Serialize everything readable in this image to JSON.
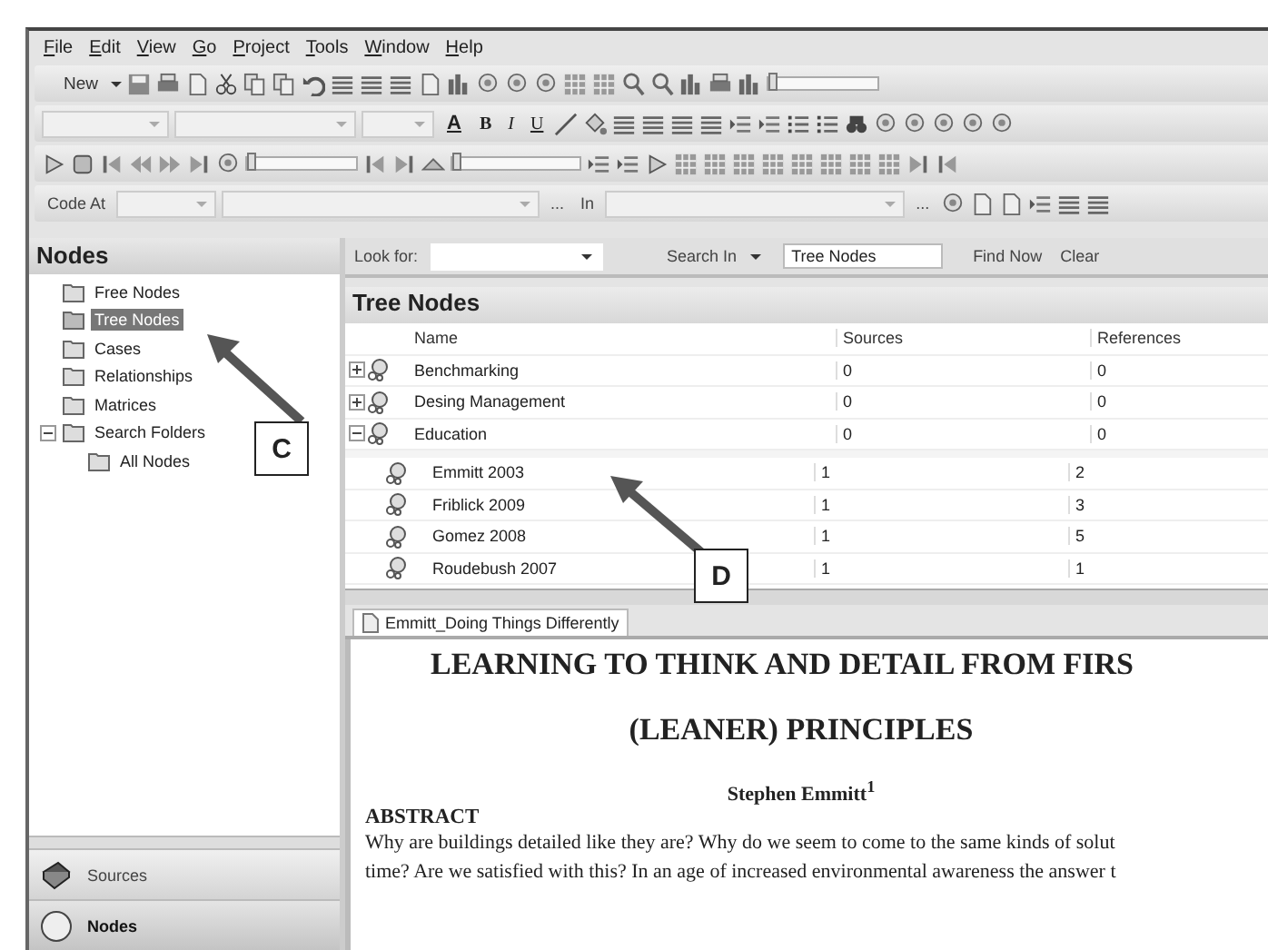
{
  "menu": [
    "File",
    "Edit",
    "View",
    "Go",
    "Project",
    "Tools",
    "Window",
    "Help"
  ],
  "toolbar": {
    "new_button": "New",
    "bold": "B",
    "italic": "I",
    "underline": "U",
    "font_color": "A",
    "code_at": "Code At",
    "in_label": "In",
    "ellipsis_1": "...",
    "ellipsis_2": "...",
    "sliders": [
      {
        "level": 0
      },
      {
        "level": 0
      },
      {
        "level": 0
      }
    ]
  },
  "navigation": {
    "title": "Nodes",
    "items": [
      {
        "label": "Free Nodes",
        "selected": false
      },
      {
        "label": "Tree Nodes",
        "selected": true
      },
      {
        "label": "Cases",
        "selected": false
      },
      {
        "label": "Relationships",
        "selected": false
      },
      {
        "label": "Matrices",
        "selected": false
      },
      {
        "label": "Search Folders",
        "selected": false,
        "expanded": true,
        "children": [
          {
            "label": "All Nodes",
            "selected": false
          }
        ]
      }
    ]
  },
  "nav_buttons": [
    {
      "label": "Sources",
      "selected": false
    },
    {
      "label": "Nodes",
      "selected": true
    }
  ],
  "find_bar": {
    "look_for_label": "Look for:",
    "search_in_label": "Search In",
    "search_in_value": "Tree Nodes",
    "find_now": "Find Now",
    "clear": "Clear"
  },
  "list": {
    "title": "Tree Nodes",
    "columns": [
      "Name",
      "Sources",
      "References"
    ],
    "rows": [
      {
        "name": "Benchmarking",
        "sources": "0",
        "references": "0",
        "expanded": false,
        "children": []
      },
      {
        "name": "Desing Management",
        "sources": "0",
        "references": "0",
        "expanded": false,
        "children": []
      },
      {
        "name": "Education",
        "sources": "0",
        "references": "0",
        "expanded": true,
        "children": [
          {
            "name": "Emmitt 2003",
            "sources": "1",
            "references": "2"
          },
          {
            "name": "Friblick 2009",
            "sources": "1",
            "references": "3"
          },
          {
            "name": "Gomez 2008",
            "sources": "1",
            "references": "5"
          },
          {
            "name": "Roudebush 2007",
            "sources": "1",
            "references": "1"
          }
        ]
      }
    ]
  },
  "document": {
    "tab": "Emmitt_Doing Things Differently",
    "title_line_1": "LEARNING TO THINK AND DETAIL FROM FIRS",
    "title_line_2": "(LEANER) PRINCIPLES",
    "author": "Stephen Emmitt$^{1}$",
    "heading": "ABSTRACT",
    "body_lines": [
      "Why are buildings detailed like they are? Why do we seem to come to the same kinds of solut",
      "time? Are we satisfied with this? In an age of increased environmental awareness the answer t"
    ]
  },
  "callouts": [
    {
      "label": "C"
    },
    {
      "label": "D"
    }
  ]
}
